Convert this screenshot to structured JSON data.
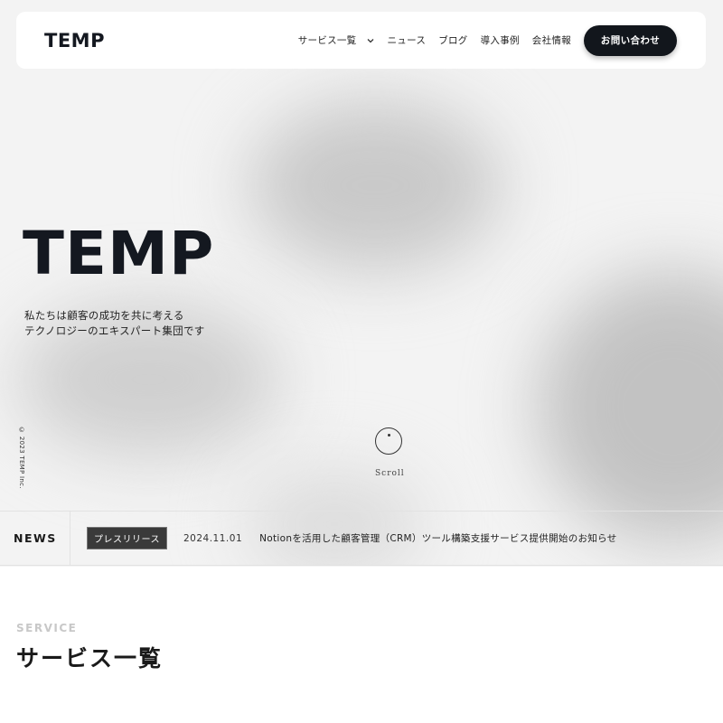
{
  "header": {
    "logo": "TEMP",
    "nav": {
      "services": "サービス一覧",
      "news": "ニュース",
      "blog": "ブログ",
      "cases": "導入事例",
      "company": "会社情報"
    },
    "contact_label": "お問い合わせ"
  },
  "hero": {
    "title": "TEMP",
    "subtitle_line1": "私たちは顧客の成功を共に考える",
    "subtitle_line2": "テクノロジーのエキスパート集団です",
    "copyright": "© 2023 TEMP Inc.",
    "scroll_label": "Scroll"
  },
  "news": {
    "label": "NEWS",
    "tag": "プレスリリース",
    "date": "2024.11.01",
    "title": "Notionを活用した顧客管理（CRM）ツール構築支援サービス提供開始のお知らせ"
  },
  "service": {
    "eyebrow": "SERVICE",
    "title": "サービス一覧"
  },
  "colors": {
    "primary_dark": "#12161c",
    "background": "#f4f4f4",
    "news_tag_bg": "#3a3a3a"
  }
}
